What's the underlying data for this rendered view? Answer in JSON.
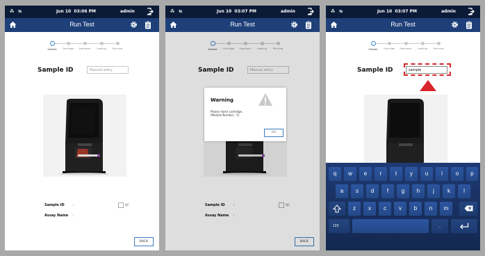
{
  "status": {
    "network": "⁂ ⇆",
    "panels": [
      {
        "date": "Jun 10",
        "time": "03:06 PM",
        "user": "admin"
      },
      {
        "date": "Jun 10",
        "time": "03:07 PM",
        "user": "admin"
      },
      {
        "date": "Jun 10",
        "time": "03:07 PM",
        "user": "admin"
      }
    ]
  },
  "header": {
    "title": "Run Test"
  },
  "steps": [
    "Sample",
    "Cartridge",
    "Specimen",
    "Loading",
    "Running"
  ],
  "sample_id": {
    "label": "Sample ID",
    "placeholder": "Manual entry",
    "value_panel3": "sample"
  },
  "bottom": {
    "sample_id_label": "Sample ID",
    "assay_name_label": "Assay Name",
    "colon": ":",
    "qc_label": "QC",
    "back_label": "BACK"
  },
  "warning": {
    "title": "Warning",
    "message_line1": "Please reject cartridge.",
    "message_line2": "(Module Number : 1)",
    "ok_label": "OK"
  },
  "keyboard": {
    "row1": [
      "q",
      "w",
      "e",
      "r",
      "t",
      "y",
      "u",
      "i",
      "o",
      "p"
    ],
    "row2": [
      "a",
      "s",
      "d",
      "f",
      "g",
      "h",
      "j",
      "k",
      "l"
    ],
    "row3": [
      "z",
      "x",
      "c",
      "v",
      "b",
      "n",
      "m"
    ],
    "numbers_key": "123",
    "period_key": "."
  },
  "colors": {
    "status_bar": "#0b1a36",
    "header": "#1e3f78",
    "accent": "#3a7cc2",
    "highlight": "#d8262c",
    "keyboard": "#1f3a73"
  },
  "icons": [
    "network-icon",
    "logout-icon",
    "home-icon",
    "gear-icon",
    "clipboard-icon",
    "warning-icon",
    "shift-icon",
    "backspace-icon",
    "enter-icon"
  ]
}
